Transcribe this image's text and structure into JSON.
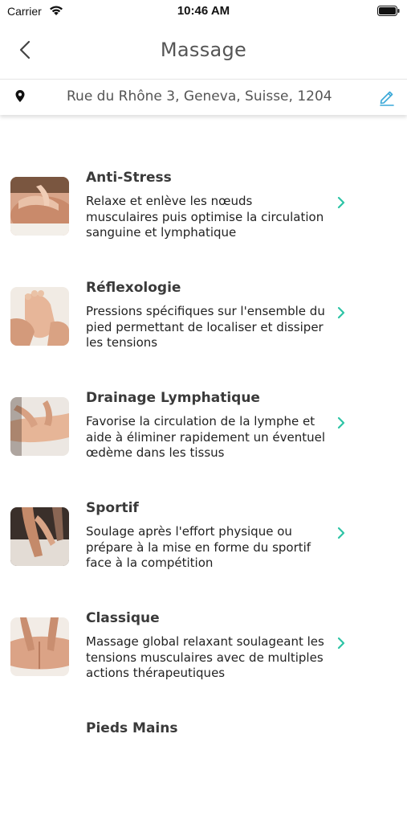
{
  "status_bar": {
    "carrier": "Carrier",
    "time": "10:46 AM"
  },
  "nav": {
    "title": "Massage"
  },
  "address": {
    "text": "Rue du Rhône 3, Geneva, Suisse, 1204"
  },
  "colors": {
    "accent": "#3aa8d8",
    "chevron": "#2ec4a6",
    "title_text": "#555555"
  },
  "services": [
    {
      "title": "Anti-Stress",
      "description": "Relaxe et enlève les nœuds musculaires puis optimise la circulation sanguine et lymphatique"
    },
    {
      "title": "Réflexologie",
      "description": "Pressions spécifiques sur l'ensemble du pied permettant de localiser et dissiper les tensions"
    },
    {
      "title": "Drainage Lymphatique",
      "description": "Favorise la circulation de la lymphe et aide à éliminer rapidement un éventuel œdème dans les tissus"
    },
    {
      "title": "Sportif",
      "description": "Soulage après l'effort physique ou prépare à la mise en forme du sportif face à la compétition"
    },
    {
      "title": "Classique",
      "description": "Massage global relaxant soulageant les tensions musculaires avec de multiples actions thérapeutiques"
    },
    {
      "title": "Pieds Mains",
      "description": ""
    }
  ]
}
